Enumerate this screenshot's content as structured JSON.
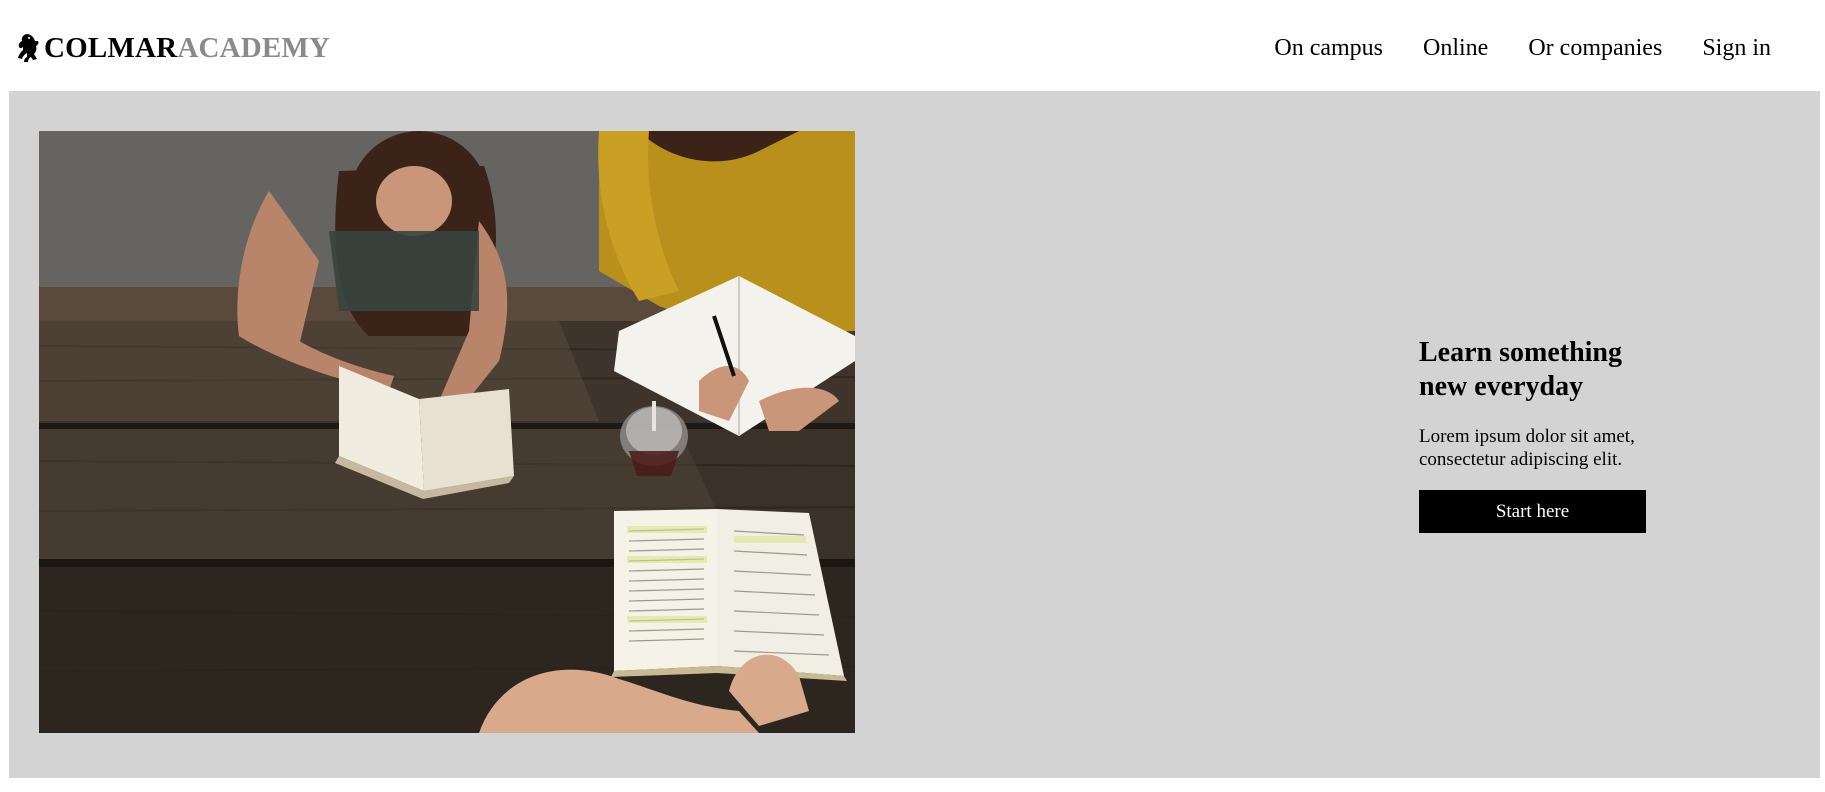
{
  "brand": {
    "logo_icon": "rearing-horse-icon",
    "name_part1": "COLMAR",
    "name_part2": "ACADEMY"
  },
  "nav": {
    "items": [
      {
        "label": "On campus"
      },
      {
        "label": "Online"
      },
      {
        "label": "Or companies"
      },
      {
        "label": "Sign in"
      }
    ]
  },
  "hero": {
    "image_description_icon": "students-reading-photo",
    "title": "Learn something new everyday",
    "description": "Lorem ipsum dolor sit amet, consectetur adipiscing elit.",
    "cta_label": "Start here"
  },
  "colors": {
    "hero_background": "#d3d3d3",
    "brand_light": "#8a8a8a",
    "cta_background": "#000000",
    "cta_text": "#ffffff"
  }
}
